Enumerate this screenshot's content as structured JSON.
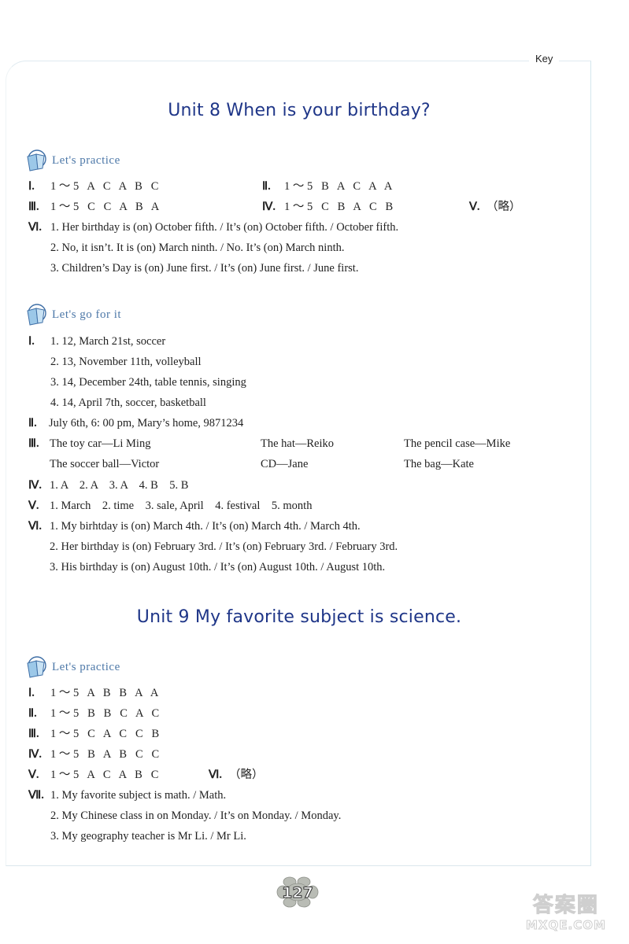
{
  "header": {
    "key_label": "Key"
  },
  "unit8": {
    "title": "Unit 8  When is your birthday?",
    "practice": {
      "heading": "Let's practice",
      "rows": [
        {
          "num": "Ⅰ.",
          "text": "1 ～ 5   A   C   A   B   C"
        },
        {
          "num": "Ⅱ.",
          "text": "1 ～ 5   B   A   C   A   A"
        },
        {
          "num": "Ⅲ.",
          "text": "1 ～ 5   C   C   A   B   A"
        },
        {
          "num": "Ⅳ.",
          "text": "1 ～ 5   C   B   A   C   B"
        },
        {
          "num": "Ⅴ.",
          "text": "（略）"
        }
      ],
      "vi": {
        "num": "Ⅵ.",
        "items": [
          "1. Her birthday is (on) October fifth. / It’s (on) October fifth. / October fifth.",
          "2. No, it isn’t. It is (on) March ninth. / No. It’s (on) March ninth.",
          "3. Children’s Day is (on) June first. / It’s (on) June first. / June first."
        ]
      }
    },
    "go_for_it": {
      "heading": "Let's go for it",
      "i": {
        "num": "Ⅰ.",
        "items": [
          "1. 12, March 21st, soccer",
          "2. 13, November 11th, volleyball",
          "3. 14, December 24th, table tennis, singing",
          "4. 14, April 7th, soccer, basketball"
        ]
      },
      "ii": {
        "num": "Ⅱ.",
        "text": "July 6th, 6: 00 pm, Mary’s home, 9871234"
      },
      "iii": {
        "num": "Ⅲ.",
        "pairs": [
          "The toy car—Li Ming",
          "The hat—Reiko",
          "The pencil case—Mike",
          "The soccer ball—Victor",
          "CD—Jane",
          "The bag—Kate"
        ]
      },
      "iv": {
        "num": "Ⅳ.",
        "text": "1. A    2. A    3. A    4. B    5. B"
      },
      "v": {
        "num": "Ⅴ.",
        "text": "1. March    2. time    3. sale, April    4. festival    5. month"
      },
      "vi": {
        "num": "Ⅵ.",
        "items": [
          "1. My birhtday is (on) March 4th. / It’s (on) March 4th. / March 4th.",
          "2. Her birthday is (on) February 3rd. / It’s (on) February 3rd. / February 3rd.",
          "3. His birthday is (on) August 10th. / It’s (on) August 10th. / August 10th."
        ]
      }
    }
  },
  "unit9": {
    "title": "Unit 9  My favorite subject is science.",
    "practice": {
      "heading": "Let's practice",
      "rows": [
        {
          "num": "Ⅰ.",
          "text": "1 ～ 5   A   B   B   A   A"
        },
        {
          "num": "Ⅱ.",
          "text": "1 ～ 5   B   B   C   A   C"
        },
        {
          "num": "Ⅲ.",
          "text": "1 ～ 5   C   A   C   C   B"
        },
        {
          "num": "Ⅳ.",
          "text": "1 ～ 5   B   A   B   C   C"
        },
        {
          "num": "Ⅴ.",
          "text": "1 ～ 5   A   C   A   B   C"
        }
      ],
      "vi": {
        "num": "Ⅵ.",
        "text": "（略）"
      },
      "vii": {
        "num": "Ⅶ.",
        "items": [
          "1. My favorite subject is math. / Math.",
          "2. My Chinese class in on Monday. / It’s on Monday. / Monday.",
          "3. My geography teacher is Mr Li. / Mr Li."
        ]
      }
    }
  },
  "footer": {
    "page_number": "127",
    "watermark_top": "答案圈",
    "watermark_bottom": "MXQE.COM"
  }
}
